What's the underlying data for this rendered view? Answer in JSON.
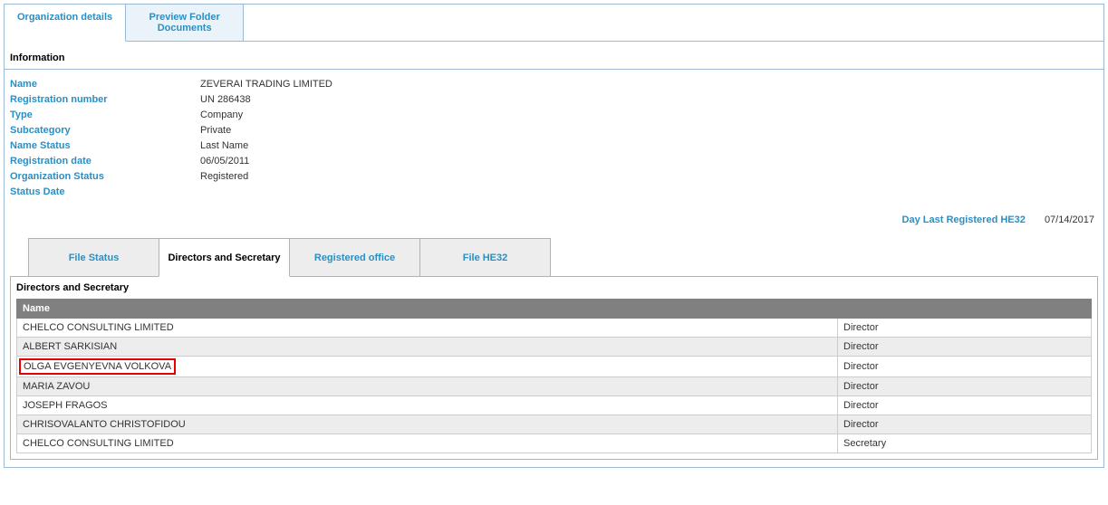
{
  "topTabs": {
    "orgDetails": "Organization details",
    "previewDocs": "Preview Folder\nDocuments"
  },
  "sectionHeading": "Information",
  "info": {
    "nameLabel": "Name",
    "nameValue": "ZEVERAI TRADING LIMITED",
    "regNumLabel": "Registration number",
    "regNumValue": "UN 286438",
    "typeLabel": "Type",
    "typeValue": "Company",
    "subcatLabel": "Subcategory",
    "subcatValue": "Private",
    "nameStatusLabel": "Name Status",
    "nameStatusValue": "Last Name",
    "regDateLabel": "Registration date",
    "regDateValue": "06/05/2011",
    "orgStatusLabel": "Organization Status",
    "orgStatusValue": "Registered",
    "statusDateLabel": "Status Date",
    "statusDateValue": ""
  },
  "dayLast": {
    "label": "Day Last Registered HE32",
    "value": "07/14/2017"
  },
  "subTabs": {
    "fileStatus": "File Status",
    "directors": "Directors and Secretary",
    "regOffice": "Registered office",
    "fileHE32": "File HE32"
  },
  "directorsHeading": "Directors and Secretary",
  "table": {
    "colName": "Name",
    "colRole": "",
    "rows": [
      {
        "name": "CHELCO CONSULTING LIMITED",
        "role": "Director",
        "highlight": false
      },
      {
        "name": "ALBERT SARKISIAN",
        "role": "Director",
        "highlight": false
      },
      {
        "name": "OLGA EVGENYEVNA VOLKOVA",
        "role": "Director",
        "highlight": true
      },
      {
        "name": "MARIA ZAVOU",
        "role": "Director",
        "highlight": false
      },
      {
        "name": "JOSEPH FRAGOS",
        "role": "Director",
        "highlight": false
      },
      {
        "name": "CHRISOVALANTO CHRISTOFIDOU",
        "role": "Director",
        "highlight": false
      },
      {
        "name": "CHELCO CONSULTING LIMITED",
        "role": "Secretary",
        "highlight": false
      }
    ]
  }
}
